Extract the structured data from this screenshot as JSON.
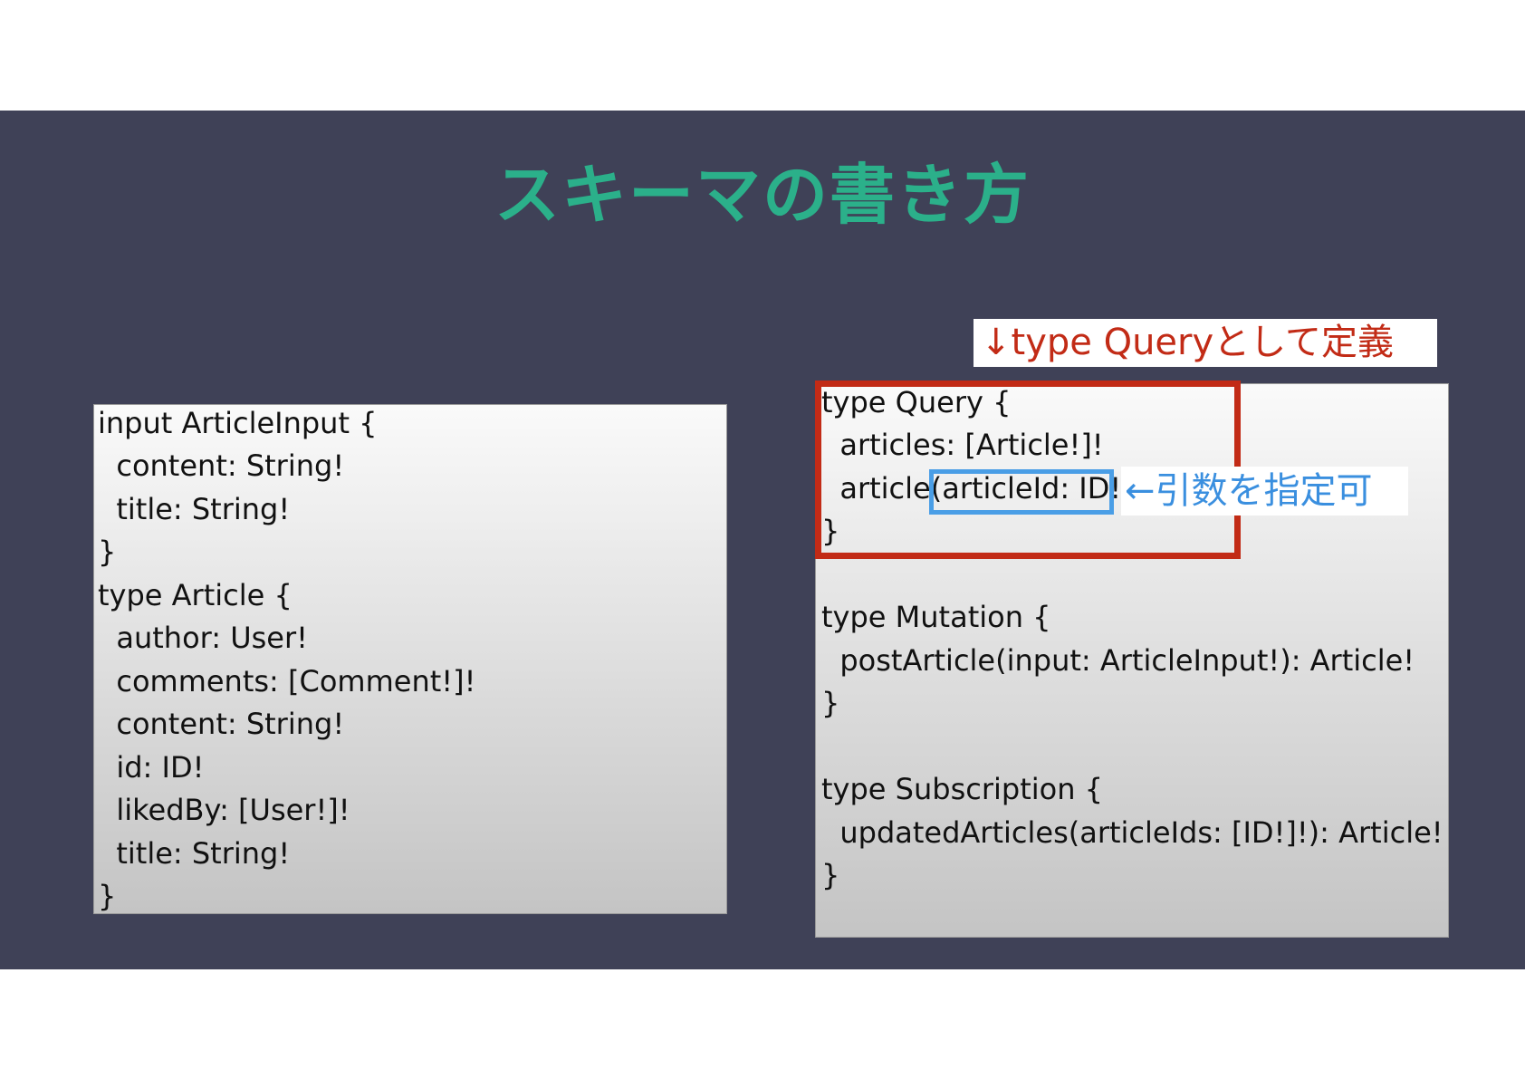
{
  "slide": {
    "title": "スキーマの書き方"
  },
  "left_code": [
    "input ArticleInput {",
    "  content: String!",
    "  title: String!",
    "}",
    "type Article {",
    "  author: User!",
    "  comments: [Comment!]!",
    "  content: String!",
    "  id: ID!",
    "  likedBy: [User!]!",
    "  title: String!",
    "}"
  ],
  "right_code": [
    "type Query {",
    "  articles: [Article!]!",
    "  article(articleId: ID!): Article!",
    "}",
    "",
    "type Mutation {",
    "  postArticle(input: ArticleInput!): Article!",
    "}",
    "",
    "type Subscription {",
    "  updatedArticles(articleIds: [ID!]!): Article!",
    "}"
  ],
  "annotations": {
    "query_label": "↓type Queryとして定義",
    "arg_label": "←引数を指定可"
  },
  "colors": {
    "slide_background": "#3f4157",
    "title": "#2bb08a",
    "query_annotation": "#c22b16",
    "arg_annotation": "#3a8fdf"
  }
}
